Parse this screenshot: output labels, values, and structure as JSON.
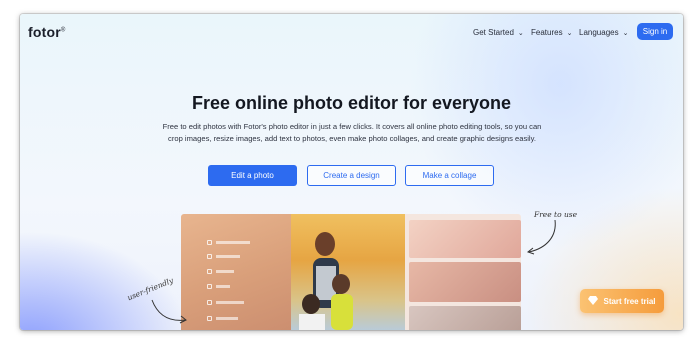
{
  "header": {
    "logo": "fotor",
    "logo_mark": "®",
    "nav": [
      {
        "label": "Get Started"
      },
      {
        "label": "Features"
      },
      {
        "label": "Languages"
      }
    ],
    "signin_label": "Sign in"
  },
  "hero": {
    "title": "Free online photo editor for everyone",
    "description": "Free to edit photos with Fotor's photo editor in just a few clicks. It covers all online photo editing tools, so you can crop images, resize images, add text to photos, even make photo collages, and create graphic designs easily.",
    "buttons": {
      "edit": "Edit a photo",
      "design": "Create a design",
      "collage": "Make a collage"
    }
  },
  "preview": {
    "annotations": {
      "free": "Free to use",
      "friendly": "user-friendly"
    }
  },
  "cta": {
    "trial_label": "Start free trial"
  },
  "colors": {
    "accent": "#2d6bf0",
    "cta": "#f59c3c",
    "title": "#141821"
  }
}
